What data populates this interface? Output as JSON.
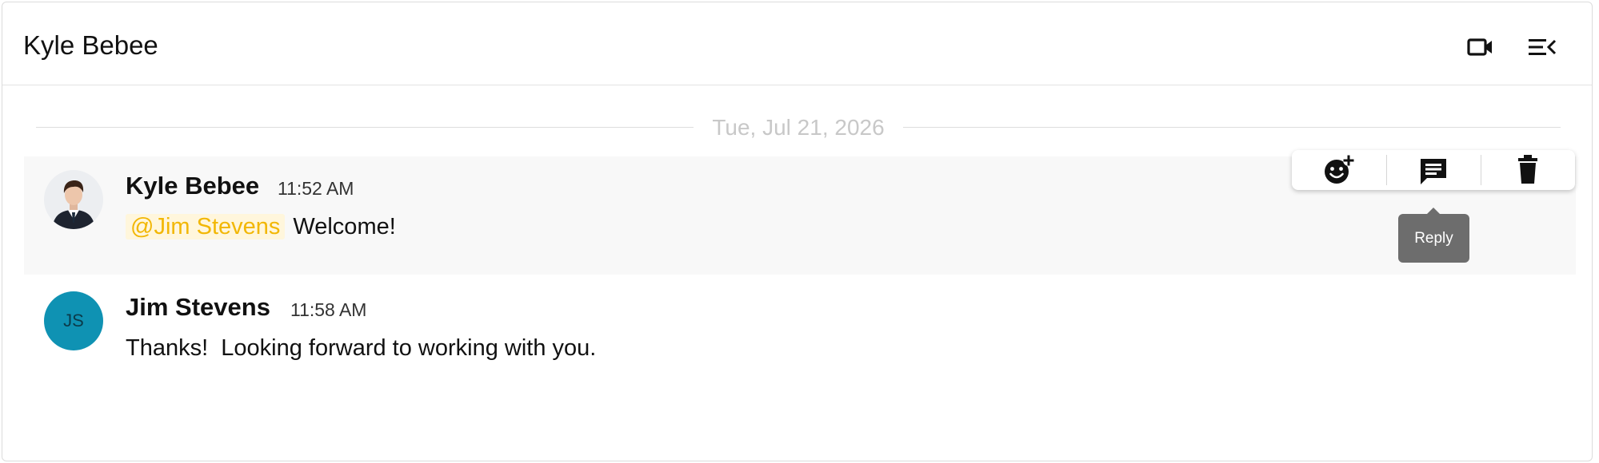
{
  "header": {
    "title": "Kyle Bebee",
    "video_icon": "video-camera-icon",
    "menu_icon": "menu-collapse-icon"
  },
  "date_divider": "Tue, Jul 21, 2026",
  "messages": [
    {
      "author": "Kyle Bebee",
      "time": "11:52 AM",
      "mention": "@Jim Stevens",
      "text": "Welcome!",
      "avatar": "profile-photo"
    },
    {
      "author": "Jim Stevens",
      "time": "11:58 AM",
      "initials": "JS",
      "text": "Thanks!  Looking forward to working with you.",
      "avatar_color": "#0f92b3"
    }
  ],
  "toolbar": {
    "add_reaction_icon": "add-reaction-icon",
    "reply_icon": "reply-icon",
    "delete_icon": "trash-icon"
  },
  "tooltip": "Reply",
  "colors": {
    "mention_text": "#f2b705",
    "mention_bg": "#fff6dc",
    "hover_bg": "#f8f8f8"
  }
}
